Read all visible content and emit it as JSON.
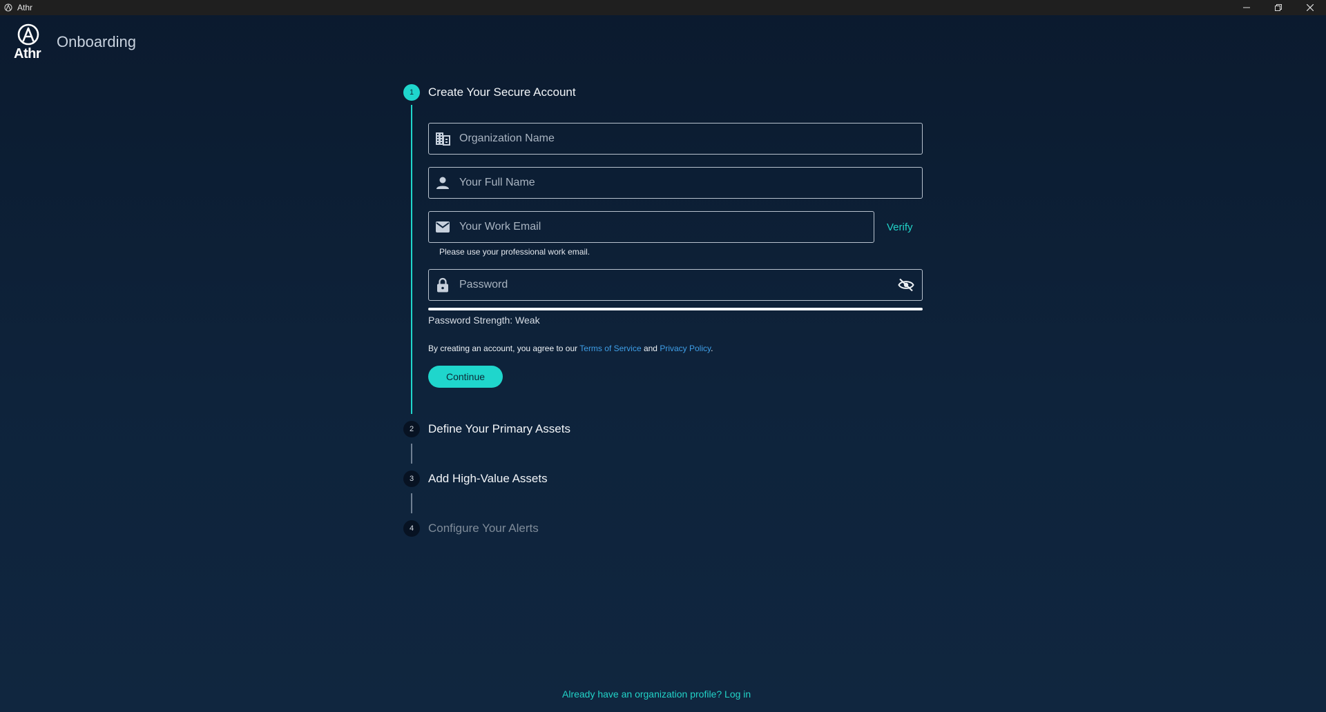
{
  "window": {
    "title": "Athr",
    "controls": [
      "minimize-icon",
      "restore-icon",
      "close-icon"
    ]
  },
  "brand": {
    "logo_text": "Athr",
    "page_title": "Onboarding"
  },
  "steps": [
    {
      "number": "1",
      "label": "Create Your Secure Account",
      "state": "active"
    },
    {
      "number": "2",
      "label": "Define Your Primary Assets",
      "state": "pending"
    },
    {
      "number": "3",
      "label": "Add High-Value Assets",
      "state": "pending"
    },
    {
      "number": "4",
      "label": "Configure Your Alerts",
      "state": "disabled"
    }
  ],
  "form": {
    "organization": {
      "placeholder": "Organization Name",
      "value": "",
      "icon": "building-icon"
    },
    "full_name": {
      "placeholder": "Your Full Name",
      "value": "",
      "icon": "person-icon"
    },
    "email": {
      "placeholder": "Your Work Email",
      "value": "",
      "icon": "envelope-icon",
      "verify_label": "Verify",
      "help": "Please use your professional work email."
    },
    "password": {
      "placeholder": "Password",
      "value": "",
      "icon": "lock-icon",
      "toggle_icon": "eye-off-icon",
      "strength_label": "Password Strength: Weak",
      "strength_fraction": 1.0
    },
    "terms": {
      "prefix": "By creating an account, you agree to our ",
      "terms_link": "Terms of Service",
      "middle": " and ",
      "privacy_link": "Privacy Policy",
      "suffix": "."
    },
    "continue_label": "Continue"
  },
  "footer": {
    "login_text": "Already have an organization profile? Log in"
  },
  "colors": {
    "accent": "#1fd6cc",
    "link": "#3f9fe8",
    "background": "#0e233b"
  }
}
